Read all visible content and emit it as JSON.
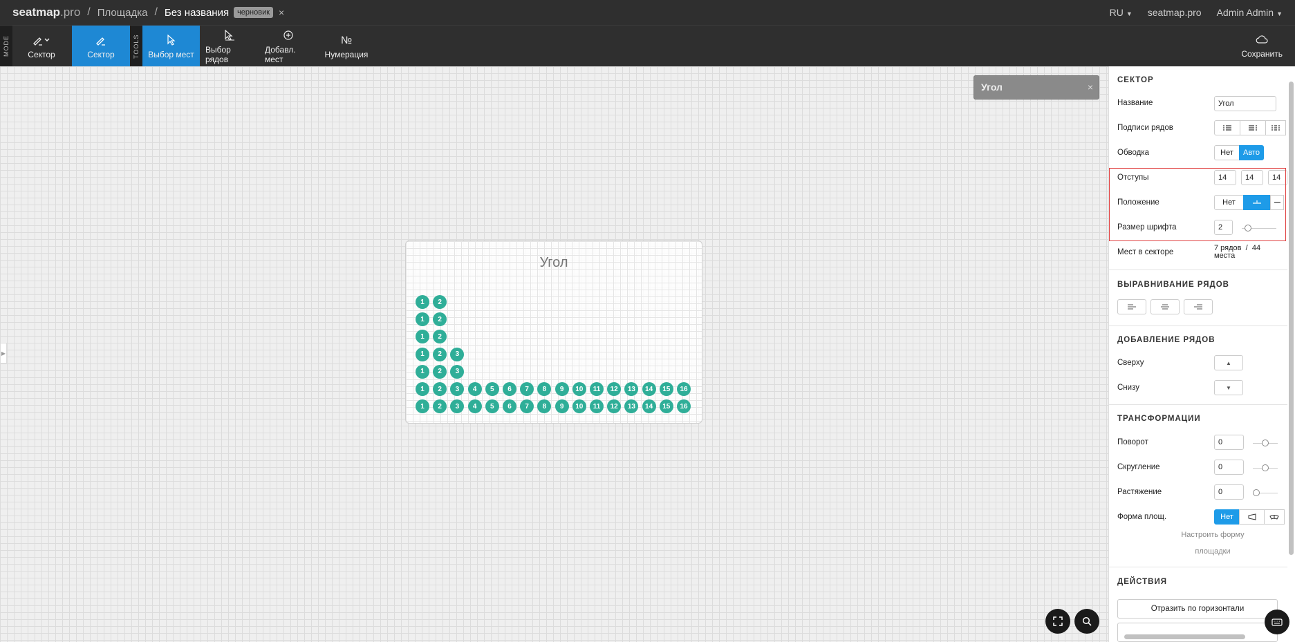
{
  "header": {
    "brand_main": "seatmap",
    "brand_suffix": ".pro",
    "crumb_sep": "/",
    "crumb_venue": "Площадка",
    "crumb_current": "Без названия",
    "draft_badge": "черновик",
    "close": "×",
    "lang": "RU",
    "site_link": "seatmap.pro",
    "user": "Admin Admin"
  },
  "toolbar": {
    "mode_label": "MODE",
    "tools_label": "TOOLS",
    "mode_sector": "Сектор",
    "sector": "Сектор",
    "select_seats": "Выбор мест",
    "select_rows": "Выбор рядов",
    "add_seats": "Добавл. мест",
    "numbering": "Нумерация",
    "numbering_glyph": "№",
    "save": "Сохранить"
  },
  "popover": {
    "title": "Угол",
    "close": "×"
  },
  "sector": {
    "title": "Угол",
    "rows": [
      [
        "1",
        "2"
      ],
      [
        "1",
        "2"
      ],
      [
        "1",
        "2"
      ],
      [
        "1",
        "2",
        "3"
      ],
      [
        "1",
        "2",
        "3"
      ],
      [
        "1",
        "2",
        "3",
        "4",
        "5",
        "6",
        "7",
        "8",
        "9",
        "10",
        "11",
        "12",
        "13",
        "14",
        "15",
        "16"
      ],
      [
        "1",
        "2",
        "3",
        "4",
        "5",
        "6",
        "7",
        "8",
        "9",
        "10",
        "11",
        "12",
        "13",
        "14",
        "15",
        "16"
      ]
    ]
  },
  "panel": {
    "sector_section": "СЕКТОР",
    "name_label": "Название",
    "name_value": "Угол",
    "row_labels_label": "Подписи рядов",
    "outline_label": "Обводка",
    "outline_none": "Нет",
    "outline_auto": "Авто",
    "padding_label": "Отступы",
    "padding_values": [
      "14",
      "14",
      "14"
    ],
    "position_label": "Положение",
    "position_none": "Нет",
    "font_size_label": "Размер шрифта",
    "font_size_value": "2",
    "seats_label": "Мест в секторе",
    "seats_rows": "7 рядов",
    "seats_sep": "/",
    "seats_count": "44",
    "seats_unit": "места",
    "align_section": "ВЫРАВНИВАНИЕ РЯДОВ",
    "add_rows_section": "ДОБАВЛЕНИЕ РЯДОВ",
    "above_label": "Сверху",
    "below_label": "Снизу",
    "transform_section": "ТРАНСФОРМАЦИИ",
    "rotate_label": "Поворот",
    "rotate_value": "0",
    "round_label": "Скругление",
    "round_value": "0",
    "stretch_label": "Растяжение",
    "stretch_value": "0",
    "shape_label": "Форма площ.",
    "shape_none": "Нет",
    "shape_link_line1": "Настроить форму",
    "shape_link_line2": "площадки",
    "actions_section": "ДЕЙСТВИЯ",
    "flip_h": "Отразить по горизонтали"
  },
  "colors": {
    "accent": "#1e88d4",
    "seat": "#2fae98",
    "toggle_on": "#1e9be8",
    "highlight": "#e04040"
  }
}
